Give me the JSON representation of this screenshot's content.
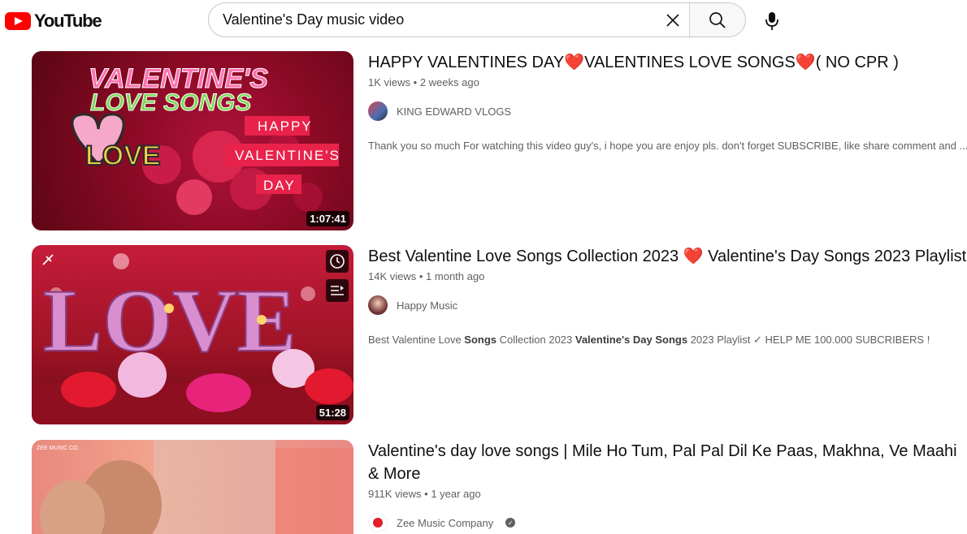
{
  "header": {
    "logo_text": "YouTube",
    "search_value": "Valentine's Day music video",
    "icons": [
      "youtube-logo-icon",
      "clear-icon",
      "search-icon",
      "mic-icon"
    ]
  },
  "results": [
    {
      "title": "HAPPY VALENTINES DAY❤️VALENTINES LOVE SONGS❤️( NO CPR )",
      "views": "1K views",
      "age": "2 weeks ago",
      "channel": "KING EDWARD VLOGS",
      "description": "Thank you so much For watching this video guy's, i hope you are enjoy pls. don't forget SUBSCRIBE, like share comment and ...",
      "duration": "1:07:41",
      "thumb_lines": [
        "VALENTINE'S",
        "LOVE SONGS",
        "HAPPY",
        "VALENTINE'S",
        "DAY",
        "LOVE"
      ]
    },
    {
      "title": "Best Valentine Love Songs Collection 2023 ❤️ Valentine's Day Songs 2023 Playlist",
      "views": "14K views",
      "age": "1 month ago",
      "channel": "Happy Music",
      "description_parts": [
        "Best Valentine Love ",
        "Songs",
        " Collection 2023 ",
        "Valentine's Day Songs",
        " 2023 Playlist ✓ HELP ME 100.000 SUBCRIBERS !"
      ],
      "duration": "51:28",
      "thumb_lines": [
        "LOVE"
      ]
    },
    {
      "title": "Valentine's day love songs | Mile Ho Tum, Pal Pal Dil Ke Paas, Makhna, Ve Maahi & More",
      "views": "911K views",
      "age": "1 year ago",
      "channel": "Zee Music Company",
      "thumb_lines": [
        "ZEE MUSIC CO."
      ]
    }
  ]
}
